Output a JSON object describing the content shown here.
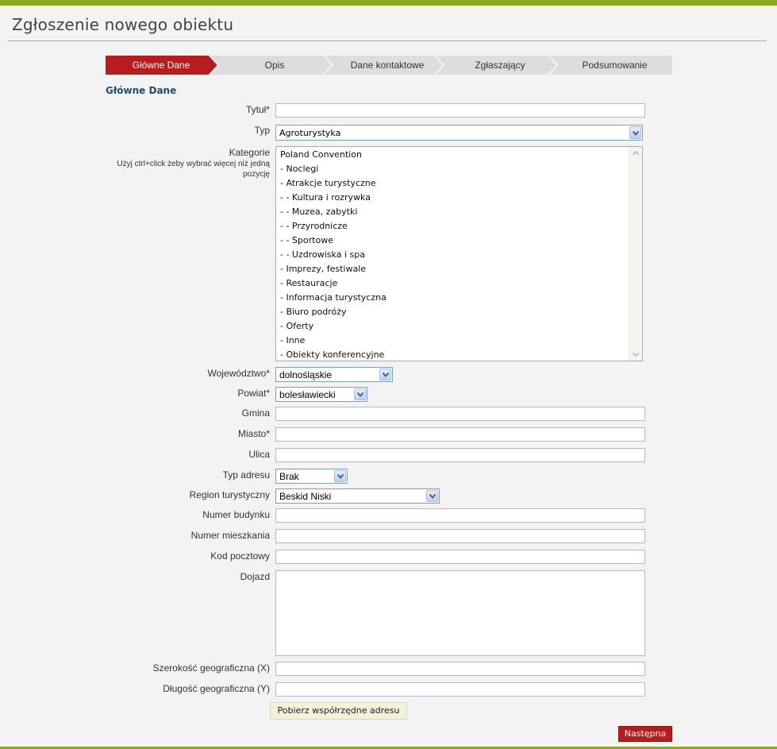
{
  "page": {
    "title": "Zgłoszenie nowego obiektu"
  },
  "colors": {
    "accent_green": "#8bab1a",
    "active_step_red": "#b81c1c",
    "heading_blue": "#1f4e79"
  },
  "steps": [
    {
      "label": "Główne Dane",
      "active": true
    },
    {
      "label": "Opis",
      "active": false
    },
    {
      "label": "Dane kontaktowe",
      "active": false
    },
    {
      "label": "Zgłaszający",
      "active": false
    },
    {
      "label": "Podsumowanie",
      "active": false
    }
  ],
  "section": {
    "heading": "Główne Dane"
  },
  "form": {
    "tytul": {
      "label": "Tytuł*",
      "value": ""
    },
    "typ": {
      "label": "Typ",
      "value": "Agroturystyka"
    },
    "kategorie": {
      "label": "Kategorie",
      "hint": "Użyj ctrl+click żeby wybrać więcej niż jedną pozycję",
      "options": [
        "Poland Convention",
        "- Noclegi",
        "- Atrakcje turystyczne",
        "- - Kultura i rozrywka",
        "- - Muzea, zabytki",
        "- - Przyrodnicze",
        "- - Sportowe",
        "- - Uzdrowiska i spa",
        "- Imprezy, festiwale",
        "- Restauracje",
        "- Informacja turystyczna",
        "- Biuro podróży",
        "- Oferty",
        "- Inne",
        "- Obiekty konferencyjne"
      ]
    },
    "wojewodztwo": {
      "label": "Województwo*",
      "value": "dolnośląskie"
    },
    "powiat": {
      "label": "Powiat*",
      "value": "bolesławiecki"
    },
    "gmina": {
      "label": "Gmina",
      "value": ""
    },
    "miasto": {
      "label": "Miasto*",
      "value": ""
    },
    "ulica": {
      "label": "Ulica",
      "value": ""
    },
    "typ_adresu": {
      "label": "Typ adresu",
      "value": "Brak"
    },
    "region": {
      "label": "Region turystyczny",
      "value": "Beskid Niski"
    },
    "numer_budynku": {
      "label": "Numer budynku",
      "value": ""
    },
    "numer_mieszkania": {
      "label": "Numer mieszkania",
      "value": ""
    },
    "kod_pocztowy": {
      "label": "Kod pocztowy",
      "value": ""
    },
    "dojazd": {
      "label": "Dojazd",
      "value": ""
    },
    "szerokosc": {
      "label": "Szerokość geograficzna (X)",
      "value": ""
    },
    "dlugosc": {
      "label": "Długość geograficzna (Y)",
      "value": ""
    }
  },
  "buttons": {
    "get_coords": "Pobierz współrzędne adresu",
    "next": "Następna"
  },
  "icons": {
    "select_arrow": "chevron-down-icon",
    "scroll_up": "scroll-up-arrow-icon",
    "scroll_down": "scroll-down-arrow-icon"
  }
}
